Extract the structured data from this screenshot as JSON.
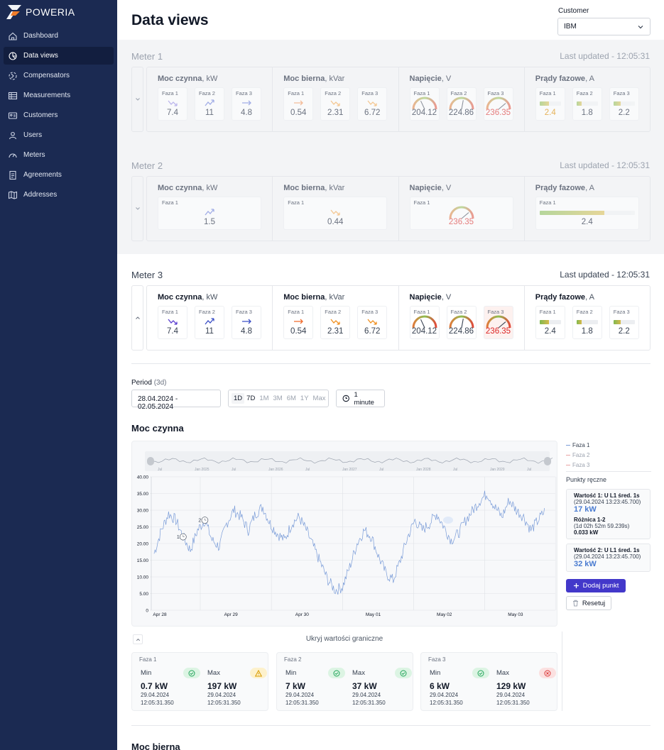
{
  "app": {
    "brand": "POWERIA"
  },
  "sidebar": {
    "items": [
      {
        "label": "Dashboard",
        "icon": "home-icon",
        "active": false
      },
      {
        "label": "Data views",
        "icon": "pie-chart-icon",
        "active": true
      },
      {
        "label": "Compensators",
        "icon": "compensator-icon",
        "active": false
      },
      {
        "label": "Measurements",
        "icon": "table-icon",
        "active": false
      },
      {
        "label": "Customers",
        "icon": "id-card-icon",
        "active": false
      },
      {
        "label": "Users",
        "icon": "users-icon",
        "active": false
      },
      {
        "label": "Meters",
        "icon": "gauge-icon",
        "active": false
      },
      {
        "label": "Agreements",
        "icon": "document-icon",
        "active": false
      },
      {
        "label": "Addresses",
        "icon": "map-icon",
        "active": false
      }
    ]
  },
  "header": {
    "title": "Data views",
    "customer_label": "Customer",
    "customer_value": "IBM"
  },
  "meters": [
    {
      "title": "Meter 1",
      "updated": "Last updated - 12:05:31",
      "groups": [
        {
          "title": "Moc czynna",
          "unit": ", kW",
          "phases": [
            {
              "label": "Faza 1",
              "value": "7.4"
            },
            {
              "label": "Faza 2",
              "value": "11"
            },
            {
              "label": "Faza 3",
              "value": "4.8"
            }
          ]
        },
        {
          "title": "Moc bierna",
          "unit": ", kVar",
          "phases": [
            {
              "label": "Faza 1",
              "value": "0.54"
            },
            {
              "label": "Faza 2",
              "value": "2.31"
            },
            {
              "label": "Faza 3",
              "value": "6.72"
            }
          ]
        },
        {
          "title": "Napięcie",
          "unit": ", V",
          "phases": [
            {
              "label": "Faza 1",
              "value": "204.12"
            },
            {
              "label": "Faza 2",
              "value": "224.86"
            },
            {
              "label": "Faza 3",
              "value": "236.35"
            }
          ]
        },
        {
          "title": "Prądy fazowe",
          "unit": ", A",
          "phases": [
            {
              "label": "Faza 1",
              "value": "2.4"
            },
            {
              "label": "Faza 2",
              "value": "1.8"
            },
            {
              "label": "Faza 3",
              "value": "2.2"
            }
          ]
        }
      ]
    },
    {
      "title": "Meter 2",
      "updated": "Last updated - 12:05:31",
      "groups": [
        {
          "title": "Moc czynna",
          "unit": ", kW",
          "phases": [
            {
              "label": "Faza 1",
              "value": "1.5"
            }
          ]
        },
        {
          "title": "Moc bierna",
          "unit": ", kVar",
          "phases": [
            {
              "label": "Faza 1",
              "value": "0.44"
            }
          ]
        },
        {
          "title": "Napięcie",
          "unit": ", V",
          "phases": [
            {
              "label": "Faza 1",
              "value": "236.35"
            }
          ]
        },
        {
          "title": "Prądy fazowe",
          "unit": ", A",
          "phases": [
            {
              "label": "Faza 1",
              "value": "2.4"
            }
          ]
        }
      ]
    },
    {
      "title": "Meter 3",
      "updated": "Last updated - 12:05:31",
      "groups": [
        {
          "title": "Moc czynna",
          "unit": ", kW",
          "phases": [
            {
              "label": "Faza 1",
              "value": "7.4"
            },
            {
              "label": "Faza 2",
              "value": "11"
            },
            {
              "label": "Faza 3",
              "value": "4.8"
            }
          ]
        },
        {
          "title": "Moc bierna",
          "unit": ", kVar",
          "phases": [
            {
              "label": "Faza 1",
              "value": "0.54"
            },
            {
              "label": "Faza 2",
              "value": "2.31"
            },
            {
              "label": "Faza 3",
              "value": "6.72"
            }
          ]
        },
        {
          "title": "Napięcie",
          "unit": ", V",
          "phases": [
            {
              "label": "Faza 1",
              "value": "204.12"
            },
            {
              "label": "Faza 2",
              "value": "224.86"
            },
            {
              "label": "Faza 3",
              "value": "236.35"
            }
          ]
        },
        {
          "title": "Prądy fazowe",
          "unit": ", A",
          "phases": [
            {
              "label": "Faza 1",
              "value": "2.4"
            },
            {
              "label": "Faza 2",
              "value": "1.8"
            },
            {
              "label": "Faza 3",
              "value": "2.2"
            }
          ]
        }
      ]
    }
  ],
  "period": {
    "label": "Period",
    "span": "(3d)",
    "date_range": "28.04.2024 - 02.05.2024",
    "ranges": [
      "1D",
      "7D",
      "1M",
      "3M",
      "6M",
      "1Y",
      "Max"
    ],
    "active_range": "1D",
    "interval": "1 minute"
  },
  "chart_section_title": "Moc czynna",
  "chart_data": {
    "type": "line",
    "yticks": [
      "40.00",
      "35.00",
      "30.00",
      "25.00",
      "20.00",
      "15.00",
      "10.00",
      "5.00",
      "0"
    ],
    "ylim": [
      0,
      40
    ],
    "xticks": [
      "Apr 28",
      "Apr 29",
      "Apr 30",
      "May 01",
      "May 02",
      "May 03"
    ],
    "navigator_labels": [
      "Jul",
      "Jan 2025",
      "Jul",
      "Jan 2026",
      "Jul",
      "Jan 2027",
      "Jul",
      "Jan 2028",
      "Jul",
      "Jan 2029",
      "Jul"
    ],
    "series": [
      {
        "name": "Faza 1",
        "color": "#7a9cd8",
        "visible": true,
        "values": [
          17,
          24,
          29,
          27,
          22,
          18,
          24,
          27,
          21,
          19,
          26,
          30,
          28,
          24,
          29,
          31,
          26,
          23,
          21,
          26,
          28,
          24,
          19,
          14,
          9,
          6,
          7,
          13,
          20,
          24,
          22,
          16,
          11,
          9,
          15,
          22,
          27,
          24,
          26,
          29,
          25,
          21,
          23,
          27,
          30,
          33,
          35,
          31,
          28,
          33,
          30,
          28,
          24,
          27,
          30
        ]
      },
      {
        "name": "Faza 2",
        "color": "#e9a3a3",
        "visible": false
      },
      {
        "name": "Faza 3",
        "color": "#e9a3a3",
        "visible": false
      }
    ],
    "markers": [
      {
        "label": "1",
        "x_index": 4
      },
      {
        "label": "2",
        "x_index": 7
      }
    ]
  },
  "legend": {
    "items": [
      "Faza 1",
      "Faza 2",
      "Faza 3"
    ]
  },
  "manual_points": {
    "title": "Punkty ręczne",
    "point1": {
      "name": "Wartość 1: U L1 śred. 1s",
      "time": "(29.04.2024 13:23:45.700)",
      "value": "17 kW"
    },
    "diff": {
      "name": "Różnica 1-2",
      "time": "(1d 02h 52m 59.239s)",
      "value": "0.033 kW"
    },
    "point2": {
      "name": "Wartość 2: U L1 śred. 1s",
      "time": "(29.04.2024 13:23:45.700)",
      "value": "32 kW"
    },
    "add_label": "Dodaj punkt",
    "reset_label": "Resetuj"
  },
  "limits": {
    "toggle_label": "Ukryj wartości graniczne",
    "cards": [
      {
        "title": "Faza 1",
        "min_label": "Min",
        "min_value": "0.7 kW",
        "min_status": "ok",
        "max_label": "Max",
        "max_value": "197 kW",
        "max_status": "warn",
        "date": "29.04.2024",
        "time": "12:05:31.350"
      },
      {
        "title": "Faza 2",
        "min_label": "Min",
        "min_value": "7 kW",
        "min_status": "ok",
        "max_label": "Max",
        "max_value": "37 kW",
        "max_status": "ok",
        "date": "29.04.2024",
        "time": "12:05:31.350"
      },
      {
        "title": "Faza 3",
        "min_label": "Min",
        "min_value": "6 kW",
        "min_status": "ok",
        "max_label": "Max",
        "max_value": "129 kW",
        "max_status": "err",
        "date": "29.04.2024",
        "time": "12:05:31.350"
      }
    ]
  },
  "second_section_title": "Moc bierna"
}
